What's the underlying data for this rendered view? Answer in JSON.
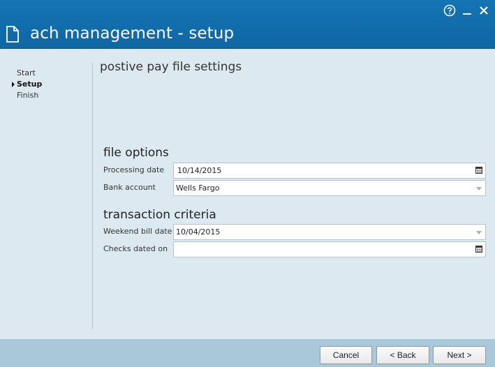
{
  "window": {
    "title": "ach management - setup",
    "title_bar_color": "#1272b2",
    "controls": [
      "help-icon",
      "minimize-icon",
      "close-icon"
    ]
  },
  "steps": [
    {
      "label": "Start",
      "active": false
    },
    {
      "label": "Setup",
      "active": true
    },
    {
      "label": "Finish",
      "active": false
    }
  ],
  "page": {
    "title": "postive pay file settings"
  },
  "file_options": {
    "heading": "file options",
    "processing_date": {
      "label": "Processing date",
      "value": "10/14/2015",
      "icon": "calendar-icon"
    },
    "bank_account": {
      "label": "Bank account",
      "value": "Wells Fargo",
      "icon": "chevron-down-icon"
    }
  },
  "transaction_criteria": {
    "heading": "transaction criteria",
    "weekend_bill_date": {
      "label": "Weekend bill date",
      "value": "10/04/2015",
      "icon": "chevron-down-icon"
    },
    "checks_dated_on": {
      "label": "Checks dated on",
      "value": "",
      "icon": "calendar-icon"
    }
  },
  "footer": {
    "cancel_label": "Cancel",
    "back_label": "< Back",
    "next_label": "Next >"
  }
}
